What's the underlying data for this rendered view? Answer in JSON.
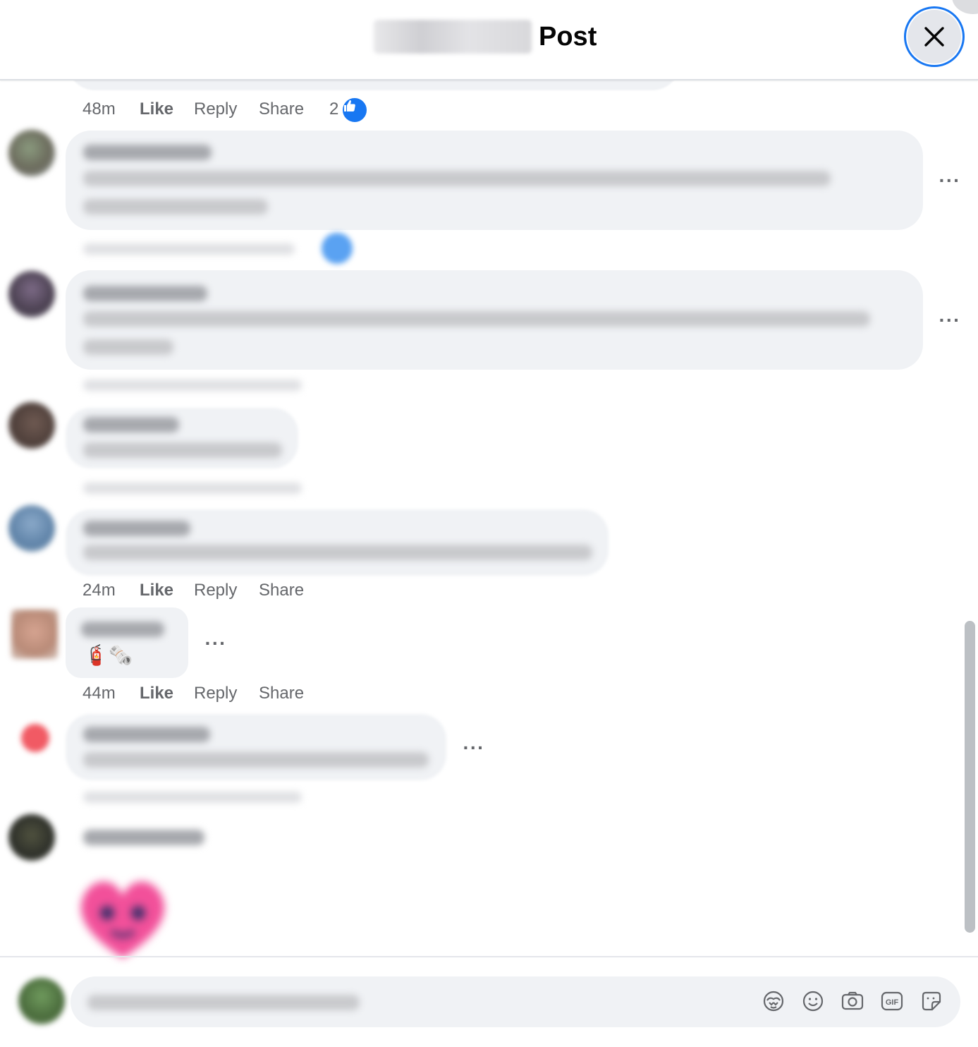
{
  "header": {
    "title_suffix": "Post",
    "close_icon": "close-icon"
  },
  "comments": {
    "c1": {
      "time": "48m",
      "like": "Like",
      "reply": "Reply",
      "share": "Share",
      "reaction_count": "2",
      "reaction_icons": [
        "like-reaction-icon",
        "love-reaction-icon"
      ]
    },
    "c5": {
      "time": "24m",
      "like": "Like",
      "reply": "Reply",
      "share": "Share"
    },
    "c6": {
      "emoji": "🧯🗞️",
      "time": "44m",
      "like": "Like",
      "reply": "Reply",
      "share": "Share"
    },
    "more_icon": "more-options-icon"
  },
  "composer": {
    "icons": [
      "avatar-sticker-icon",
      "emoji-icon",
      "camera-icon",
      "gif-icon",
      "sticker-icon"
    ]
  },
  "colors": {
    "accent": "#1877f2",
    "love": "#f33e58",
    "bubble": "#f0f2f5",
    "meta_text": "#65676b"
  }
}
